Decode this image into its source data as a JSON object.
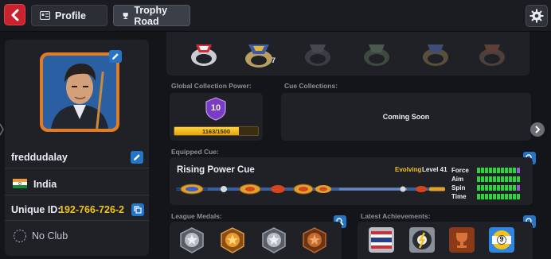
{
  "header": {
    "profile_tab": "Profile",
    "trophy_tab": "Trophy Road"
  },
  "profile": {
    "username": "freddudalay",
    "country": "India",
    "unique_id_label": "Unique ID:",
    "unique_id": "192-766-726-2",
    "club": "No Club"
  },
  "rings": {
    "badge_count": "7"
  },
  "collection": {
    "power_label": "Global Collection Power:",
    "level": "10",
    "progress_text": "1163/1500",
    "progress_fraction": 0.775,
    "cue_collections_label": "Cue Collections:",
    "cue_collections_status": "Coming Soon"
  },
  "equipped": {
    "label": "Equipped Cue:",
    "cue_name": "Rising Power Cue",
    "evolving": "Evolving",
    "level_text": "Level 41",
    "stats": [
      {
        "name": "Force",
        "filled": 10,
        "total": 11,
        "extra": "purple"
      },
      {
        "name": "Aim",
        "filled": 11,
        "total": 11,
        "extra": ""
      },
      {
        "name": "Spin",
        "filled": 10,
        "total": 11,
        "extra": "purple"
      },
      {
        "name": "Time",
        "filled": 11,
        "total": 11,
        "extra": ""
      }
    ]
  },
  "league": {
    "label": "League Medals:"
  },
  "achievements": {
    "label": "Latest Achievements:",
    "ball_number": "9"
  },
  "colors": {
    "accent_blue": "#2474c7",
    "gold": "#f3b21b",
    "stat_green": "#2fd33e",
    "back_red": "#c9232f"
  }
}
